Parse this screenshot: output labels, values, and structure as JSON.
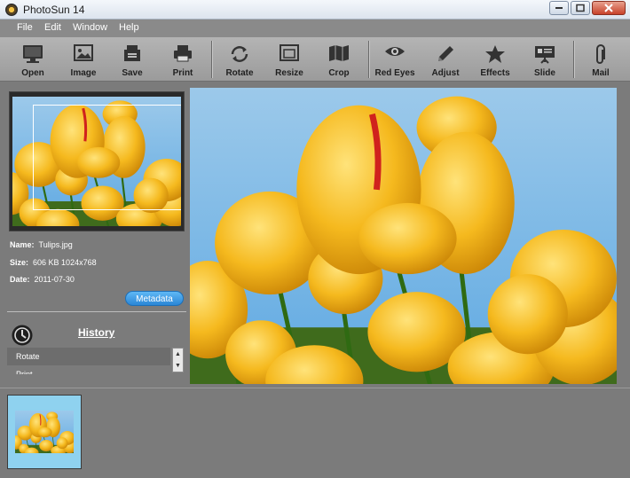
{
  "window": {
    "title": "PhotoSun 14"
  },
  "menu": [
    "File",
    "Edit",
    "Window",
    "Help"
  ],
  "toolbar": [
    {
      "label": "Open",
      "icon": "monitor-icon"
    },
    {
      "label": "Image",
      "icon": "image-icon"
    },
    {
      "label": "Save",
      "icon": "save-icon"
    },
    {
      "label": "Print",
      "icon": "print-icon"
    },
    {
      "label": "Rotate",
      "icon": "rotate-icon"
    },
    {
      "label": "Resize",
      "icon": "resize-icon"
    },
    {
      "label": "Crop",
      "icon": "crop-map-icon"
    },
    {
      "label": "Red Eyes",
      "icon": "eye-icon"
    },
    {
      "label": "Adjust",
      "icon": "pencil-icon"
    },
    {
      "label": "Effects",
      "icon": "star-icon"
    },
    {
      "label": "Slide",
      "icon": "slideshow-icon"
    },
    {
      "label": "Mail",
      "icon": "paperclip-icon"
    }
  ],
  "info": {
    "name_label": "Name:",
    "name_value": "Tulips.jpg",
    "size_label": "Size:",
    "size_value": "606 KB  1024x768",
    "date_label": "Date:",
    "date_value": "2011-07-30"
  },
  "metadata_button": "Metadata",
  "history": {
    "title": "History",
    "items": [
      "Rotate",
      "Print"
    ]
  },
  "colors": {
    "accent": "#2a86d6",
    "toolbar_bg": "#a8a8a8",
    "panel_bg": "#7b7b7b"
  }
}
